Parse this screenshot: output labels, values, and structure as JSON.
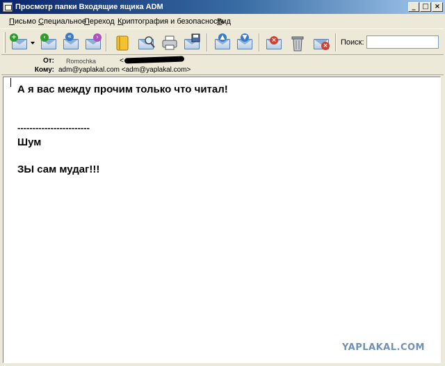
{
  "window": {
    "title": "Просмотр папки Входящие ящика ADM",
    "minimize_glyph": "_",
    "maximize_glyph": "□",
    "close_glyph": "×"
  },
  "menu": {
    "items": [
      {
        "label": "Письмо",
        "accel": "П",
        "rest": "исьмо"
      },
      {
        "label": "Специальное",
        "accel": "С",
        "rest": "пециальное"
      },
      {
        "label": "Переход",
        "accel": "П",
        "rest": "ереход"
      },
      {
        "label": "Криптография и безопасность",
        "accel": "К",
        "rest": "риптография и безопасность"
      },
      {
        "label": "Вид",
        "accel": "В",
        "rest": "ид"
      }
    ]
  },
  "toolbar": {
    "search_label": "Поиск:",
    "search_value": "",
    "icons": [
      "new-mail-icon",
      "dropdown-arrow-icon",
      "reply-icon",
      "reply-all-icon",
      "forward-icon",
      "address-book-icon",
      "find-icon",
      "print-icon",
      "save-icon",
      "previous-message-icon",
      "next-message-icon",
      "mark-unread-icon",
      "trash-icon",
      "delete-icon"
    ]
  },
  "header": {
    "from_label": "От:",
    "from_name": "Romochka",
    "from_email_open": "<",
    "to_label": "Кому:",
    "to_value": "adm@yaplakal.com <adm@yaplakal.com>"
  },
  "message": {
    "lines": [
      "А я вас между прочим только что читал!",
      "------------------------",
      "Шум",
      "ЗЫ сам мудаг!!!"
    ]
  },
  "watermark": "YAPLAKAL.COM",
  "colors": {
    "titlebar_start": "#0a246a",
    "titlebar_end": "#a6caf0",
    "chrome": "#ece9d8",
    "watermark": "#6f8fb5"
  }
}
